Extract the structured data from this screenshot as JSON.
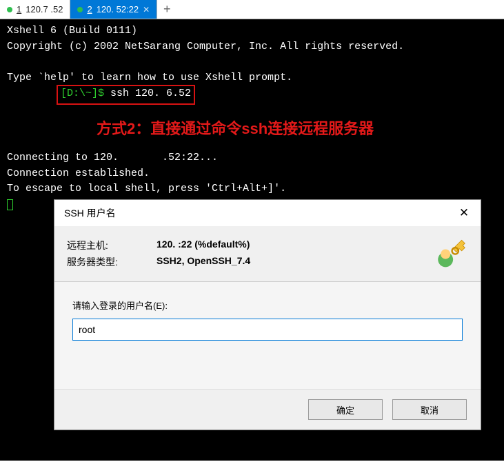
{
  "tabs": {
    "items": [
      {
        "num": "1",
        "label": "120.7        .52"
      },
      {
        "num": "2",
        "label": "120.          52:22"
      }
    ],
    "plus": "+"
  },
  "terminal": {
    "banner1": "Xshell 6 (Build 0111)",
    "banner2": "Copyright (c) 2002 NetSarang Computer, Inc. All rights reserved.",
    "help": "Type `help' to learn how to use Xshell prompt.",
    "prompt": "[D:\\~]$ ",
    "cmd": "ssh 120.      6.52",
    "annot": "方式2：直接通过命令ssh连接远程服务器",
    "l1": "Connecting to 120.       .52:22...",
    "l2": "Connection established.",
    "l3": "To escape to local shell, press 'Ctrl+Alt+]'."
  },
  "dialog": {
    "title": "SSH 用户名",
    "rhost_lbl": "远程主机:",
    "rhost_val": "120.           :22 (%default%)",
    "stype_lbl": "服务器类型:",
    "stype_val": "SSH2, OpenSSH_7.4",
    "input_lbl": "请输入登录的用户名(E):",
    "input_val": "root",
    "ok": "确定",
    "cancel": "取消"
  }
}
